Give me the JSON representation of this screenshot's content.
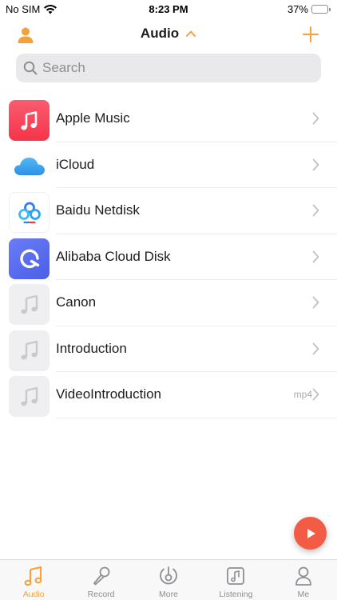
{
  "status_bar": {
    "carrier": "No SIM",
    "time": "8:23 PM",
    "battery_percent": "37%",
    "battery_level": 0.37
  },
  "nav": {
    "title": "Audio"
  },
  "search": {
    "placeholder": "Search"
  },
  "items": [
    {
      "label": "Apple Music",
      "icon": "apple-music-icon",
      "ext": ""
    },
    {
      "label": "iCloud",
      "icon": "icloud-icon",
      "ext": ""
    },
    {
      "label": "Baidu Netdisk",
      "icon": "baidu-netdisk-icon",
      "ext": ""
    },
    {
      "label": "Alibaba Cloud Disk",
      "icon": "alibaba-cloud-disk-icon",
      "ext": ""
    },
    {
      "label": "Canon",
      "icon": "music-note-icon",
      "ext": ""
    },
    {
      "label": "Introduction",
      "icon": "music-note-icon",
      "ext": ""
    },
    {
      "label": "VideoIntroduction",
      "icon": "music-note-icon",
      "ext": "mp4"
    }
  ],
  "tabs": [
    {
      "label": "Audio",
      "icon": "music-note-icon",
      "active": true
    },
    {
      "label": "Record",
      "icon": "microphone-icon",
      "active": false
    },
    {
      "label": "More",
      "icon": "more-disc-icon",
      "active": false
    },
    {
      "label": "Listening",
      "icon": "listening-icon",
      "active": false
    },
    {
      "label": "Me",
      "icon": "person-icon",
      "active": false
    }
  ],
  "colors": {
    "accent": "#f5a13a",
    "fab": "#f25b44",
    "battery": "#34c759"
  }
}
